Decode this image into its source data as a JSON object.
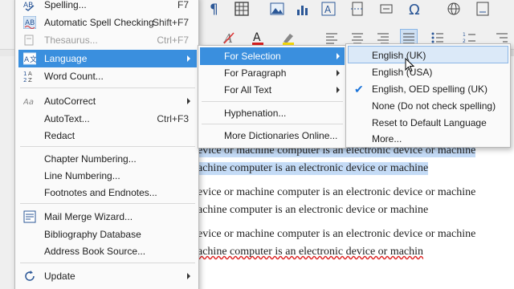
{
  "tools_menu": {
    "items": [
      {
        "label": "Spelling...",
        "shortcut": "F7",
        "icon": "spellcheck-icon"
      },
      {
        "label": "Automatic Spell Checking",
        "shortcut": "Shift+F7",
        "icon": "auto-spellcheck-icon"
      },
      {
        "label": "Thesaurus...",
        "shortcut": "Ctrl+F7",
        "icon": "thesaurus-icon"
      },
      {
        "label": "Language",
        "icon": "language-icon"
      },
      {
        "label": "Word Count...",
        "icon": "word-count-icon"
      },
      {
        "label": "AutoCorrect",
        "icon": "autocorrect-icon"
      },
      {
        "label": "AutoText...",
        "shortcut": "Ctrl+F3"
      },
      {
        "label": "Redact"
      },
      {
        "label": "Chapter Numbering..."
      },
      {
        "label": "Line Numbering..."
      },
      {
        "label": "Footnotes and Endnotes..."
      },
      {
        "label": "Mail Merge Wizard...",
        "icon": "mail-merge-icon"
      },
      {
        "label": "Bibliography Database"
      },
      {
        "label": "Address Book Source..."
      },
      {
        "label": "Update",
        "icon": "update-icon"
      }
    ]
  },
  "language_menu": {
    "items": [
      {
        "label": "For Selection"
      },
      {
        "label": "For Paragraph"
      },
      {
        "label": "For All Text"
      },
      {
        "label": "Hyphenation..."
      },
      {
        "label": "More Dictionaries Online..."
      }
    ]
  },
  "selection_menu": {
    "items": [
      {
        "label": "English (UK)"
      },
      {
        "label": "English (USA)"
      },
      {
        "label": "English, OED spelling (UK)",
        "checked": true
      },
      {
        "label": "None (Do not check spelling)"
      },
      {
        "label": "Reset to Default Language"
      },
      {
        "label": "More..."
      }
    ]
  },
  "document": {
    "lines": [
      "evice or machine computer is an electronic device or machine",
      "achine computer is an electronic device or machine",
      "evice or machine computer is an electronic device or machine",
      "achine computer is an electronic device or machine",
      "evice or machine computer is an electronic device or machine",
      "achine computer is an electronic device or machin"
    ]
  },
  "colors": {
    "accent": "#3a8fde",
    "selection_highlight": "#c4dbf6",
    "toolbar_icon": "#2b5797"
  }
}
